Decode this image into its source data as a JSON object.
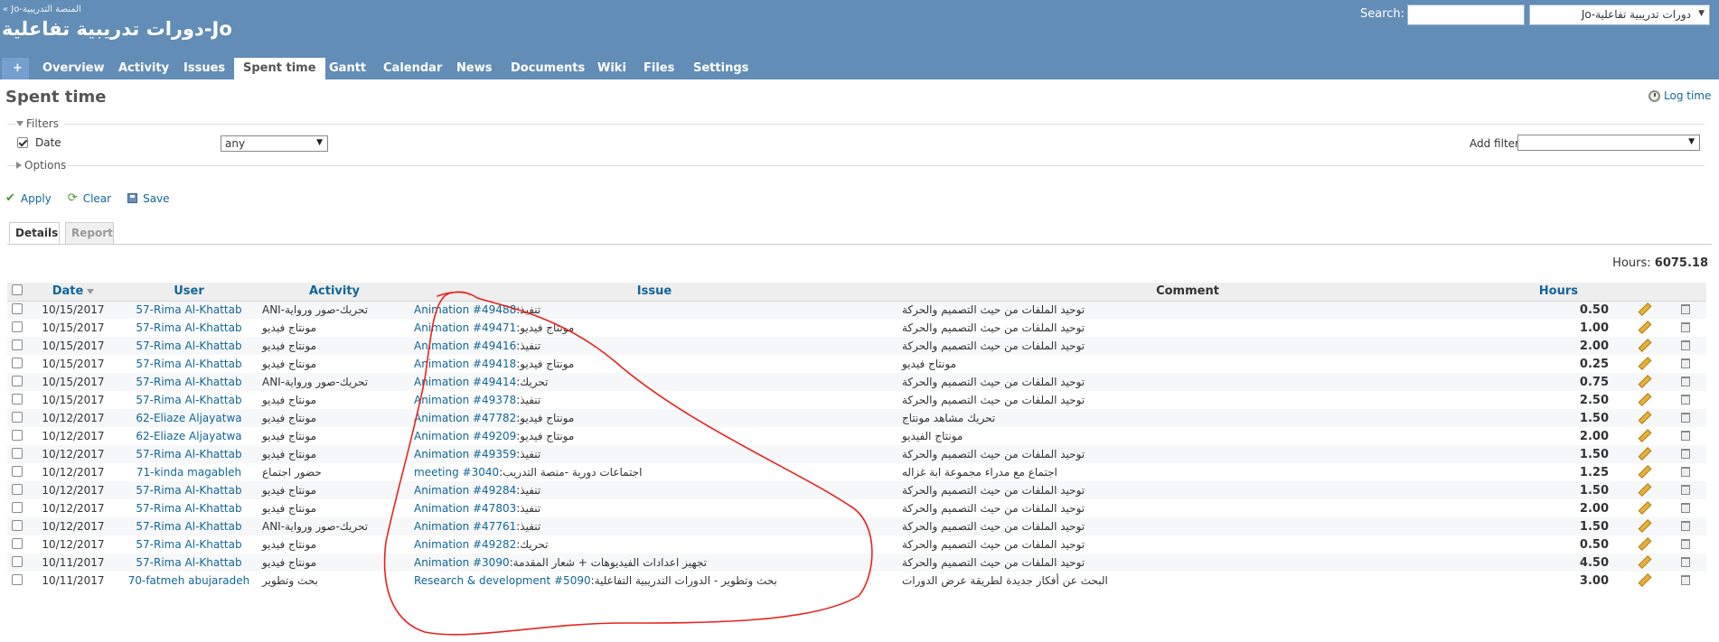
{
  "header": {
    "root_link": "المنصة التدريبية-Jo »",
    "project_title": "دورات تدريبية تفاعلية-Jo",
    "search_label": "Search:",
    "search_value": "",
    "jump_value": "دورات تدريبية تفاعلية-Jo"
  },
  "menu": {
    "plus": "+",
    "items": [
      "Overview",
      "Activity",
      "Issues",
      "Spent time",
      "Gantt",
      "Calendar",
      "News",
      "Documents",
      "Wiki",
      "Files",
      "Settings"
    ],
    "selected": "Spent time"
  },
  "page": {
    "title": "Spent time",
    "log_time": "Log time"
  },
  "filters": {
    "legend": "Filters",
    "date_label": "Date",
    "date_operator": "any",
    "add_filter_label": "Add filter",
    "options_legend": "Options"
  },
  "actions": {
    "apply": "Apply",
    "clear": "Clear",
    "save": "Save"
  },
  "tabs": {
    "details": "Details",
    "report": "Report"
  },
  "totals": {
    "label": "Hours:",
    "value": "6075.18"
  },
  "table": {
    "headers": {
      "date": "Date",
      "user": "User",
      "activity": "Activity",
      "issue": "Issue",
      "comment": "Comment",
      "hours": "Hours"
    },
    "rows": [
      {
        "date": "10/15/2017",
        "user": "57-Rima Al-Khattab",
        "activity": "ANI-تحريك-صور ورواية",
        "issue_link": "Animation #49488",
        "issue_subject": "تنفيذ",
        "comment": "توحيد الملفات من حيث التصميم والحركة",
        "hours": "0.50"
      },
      {
        "date": "10/15/2017",
        "user": "57-Rima Al-Khattab",
        "activity": "مونتاج فيديو",
        "issue_link": "Animation #49471",
        "issue_subject": "مونتاج فيديو",
        "comment": "توحيد الملفات من حيث التصميم والحركة",
        "hours": "1.00"
      },
      {
        "date": "10/15/2017",
        "user": "57-Rima Al-Khattab",
        "activity": "مونتاج فيديو",
        "issue_link": "Animation #49416",
        "issue_subject": "تنفيذ",
        "comment": "توحيد الملفات من حيث التصميم والحركة",
        "hours": "2.00"
      },
      {
        "date": "10/15/2017",
        "user": "57-Rima Al-Khattab",
        "activity": "مونتاج فيديو",
        "issue_link": "Animation #49418",
        "issue_subject": "مونتاج فيديو",
        "comment": "مونتاج فيديو",
        "hours": "0.25"
      },
      {
        "date": "10/15/2017",
        "user": "57-Rima Al-Khattab",
        "activity": "ANI-تحريك-صور ورواية",
        "issue_link": "Animation #49414",
        "issue_subject": "تحريك",
        "comment": "توحيد الملفات من حيث التصميم والحركة",
        "hours": "0.75"
      },
      {
        "date": "10/15/2017",
        "user": "57-Rima Al-Khattab",
        "activity": "مونتاج فيديو",
        "issue_link": "Animation #49378",
        "issue_subject": "تنفيذ",
        "comment": "توحيد الملفات من حيث التصميم والحركة",
        "hours": "2.50"
      },
      {
        "date": "10/12/2017",
        "user": "62-Eliaze Aljayatwa",
        "activity": "مونتاج فيديو",
        "issue_link": "Animation #47782",
        "issue_subject": "مونتاج فيديو",
        "comment": "تحريك مشاهد مونتاج",
        "hours": "1.50"
      },
      {
        "date": "10/12/2017",
        "user": "62-Eliaze Aljayatwa",
        "activity": "مونتاج فيديو",
        "issue_link": "Animation #49209",
        "issue_subject": "مونتاج فيديو",
        "comment": "مونتاج الفيديو",
        "hours": "2.00"
      },
      {
        "date": "10/12/2017",
        "user": "57-Rima Al-Khattab",
        "activity": "مونتاج فيديو",
        "issue_link": "Animation #49359",
        "issue_subject": "تنفيذ",
        "comment": "توحيد الملفات من حيث التصميم والحركة",
        "hours": "1.50"
      },
      {
        "date": "10/12/2017",
        "user": "71-kinda magableh",
        "activity": "حضور اجتماع",
        "issue_link": "meeting #3040",
        "issue_subject": "اجتماعات دورية -منصة التدريب",
        "comment": "اجتماع مع مدراء مجموعة ابة غزاله",
        "hours": "1.25"
      },
      {
        "date": "10/12/2017",
        "user": "57-Rima Al-Khattab",
        "activity": "مونتاج فيديو",
        "issue_link": "Animation #49284",
        "issue_subject": "تنفيذ",
        "comment": "توحيد الملفات من حيث التصميم والحركة",
        "hours": "1.50"
      },
      {
        "date": "10/12/2017",
        "user": "57-Rima Al-Khattab",
        "activity": "مونتاج فيديو",
        "issue_link": "Animation #47803",
        "issue_subject": "تنفيذ",
        "comment": "توحيد الملفات من حيث التصميم والحركة",
        "hours": "2.00"
      },
      {
        "date": "10/12/2017",
        "user": "57-Rima Al-Khattab",
        "activity": "ANI-تحريك-صور ورواية",
        "issue_link": "Animation #47761",
        "issue_subject": "تنفيذ",
        "comment": "توحيد الملفات من حيث التصميم والحركة",
        "hours": "1.50"
      },
      {
        "date": "10/12/2017",
        "user": "57-Rima Al-Khattab",
        "activity": "مونتاج فيديو",
        "issue_link": "Animation #49282",
        "issue_subject": "تحريك",
        "comment": "توحيد الملفات من حيث التصميم والحركة",
        "hours": "0.50"
      },
      {
        "date": "10/11/2017",
        "user": "57-Rima Al-Khattab",
        "activity": "مونتاج فيديو",
        "issue_link": "Animation #3090",
        "issue_subject": "تجهيز اعدادات الفيديوهات + شعار المقدمة",
        "comment": "توحيد الملفات من حيث التصميم والحركة",
        "hours": "4.50"
      },
      {
        "date": "10/11/2017",
        "user": "70-fatmeh abujaradeh",
        "activity": "بحث وتطوير",
        "issue_link": "Research & development #5090",
        "issue_subject": "بحث وتطوير - الدورات التدريبية التفاعلية",
        "comment": "البحث عن أفكار جديدة لطريقة عرض الدورات",
        "hours": "3.00"
      }
    ]
  },
  "colors": {
    "header_bg": "#628db6",
    "link": "#116699",
    "annotation": "#e8231f"
  }
}
